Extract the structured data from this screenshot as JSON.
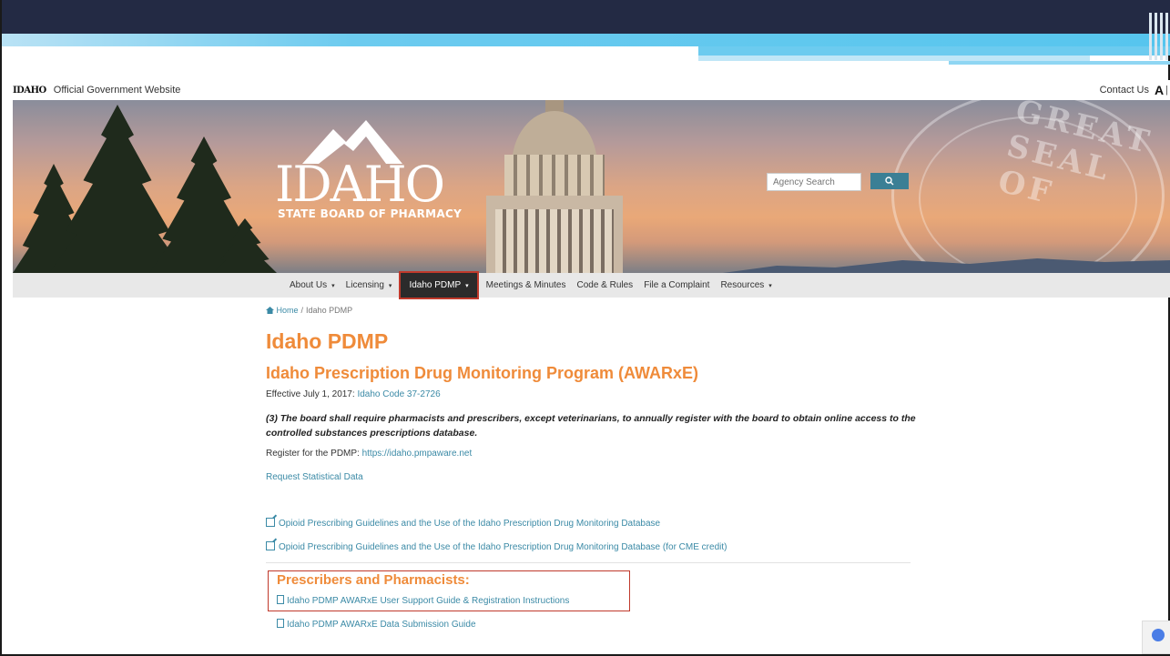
{
  "gov_bar": {
    "logo": "IDAHO",
    "official_text": "Official Government Website",
    "contact": "Contact Us",
    "text_size": "A"
  },
  "header": {
    "agency_word": "IDAHO",
    "agency_sub": "STATE BOARD OF PHARMACY",
    "search_placeholder": "Agency Search",
    "seal_text": "GREAT SEAL OF"
  },
  "nav": {
    "items": [
      {
        "label": "About Us",
        "caret": "▾"
      },
      {
        "label": "Licensing",
        "caret": "▾"
      },
      {
        "label": "Idaho PDMP",
        "caret": "▾"
      },
      {
        "label": "Meetings & Minutes"
      },
      {
        "label": "Code & Rules"
      },
      {
        "label": "File a Complaint"
      },
      {
        "label": "Resources",
        "caret": "▾"
      }
    ]
  },
  "breadcrumb": {
    "home": "Home",
    "separator": "/",
    "current": "Idaho PDMP"
  },
  "page": {
    "title": "Idaho PDMP",
    "subtitle": "Idaho Prescription Drug Monitoring Program (AWARxE)",
    "effective_prefix": "Effective July 1, 2017: ",
    "effective_link": "Idaho Code 37-2726",
    "quote": "(3) The board shall require pharmacists and prescribers, except veterinarians, to annually register with the board to obtain online access to the controlled substances prescriptions database.",
    "register_prefix": "Register for the PDMP: ",
    "register_link": "https://idaho.pmpaware.net",
    "request_link": "Request Statistical Data",
    "guideline_1": "Opioid Prescribing Guidelines and the Use of the Idaho Prescription Drug Monitoring Database",
    "guideline_2": "Opioid Prescribing Guidelines and the Use of the Idaho Prescription Drug Monitoring Database (for CME credit)",
    "section_heading": "Prescribers and Pharmacists:",
    "pdf_1": "Idaho PDMP AWARxE User Support Guide & Registration Instructions",
    "pdf_2": "Idaho PDMP AWARxE Data Submission Guide"
  },
  "colors": {
    "accent_orange": "#ef8b3a",
    "link_teal": "#3b8aa6",
    "highlight_red": "#c0392b",
    "slide_top": "#232a44"
  }
}
